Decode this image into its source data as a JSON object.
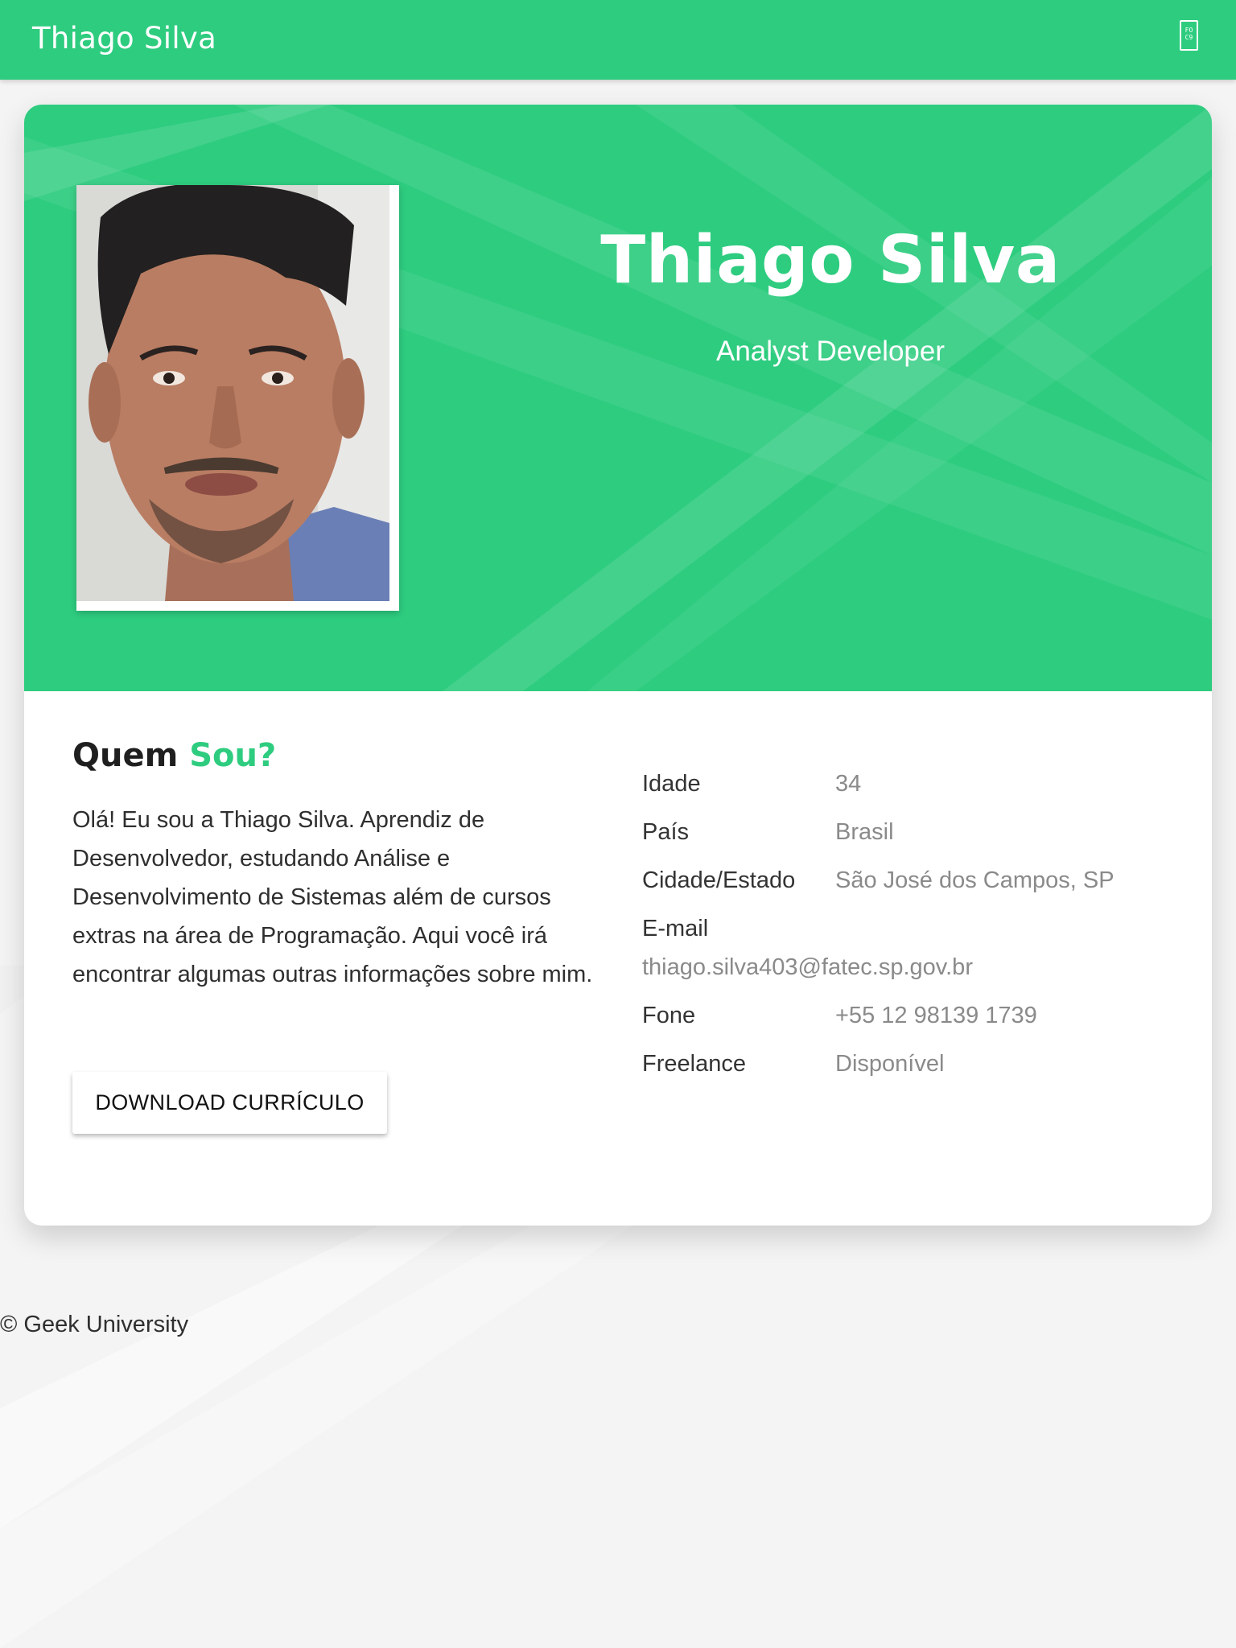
{
  "header": {
    "brand": "Thiago Silva",
    "menu_icon": "menu-icon",
    "menu_icon_glyph": "FO\nC9"
  },
  "colors": {
    "accent": "#2ecc7f",
    "page_bg": "#f4f4f4"
  },
  "hero": {
    "name": "Thiago Silva",
    "role": "Analyst Developer",
    "photo_icon": "profile-photo"
  },
  "about": {
    "title_part1": "Quem",
    "title_part2": "Sou?",
    "paragraph": "Olá! Eu sou a Thiago Silva. Aprendiz de Desenvolvedor, estudando Análise e Desenvolvimento de Sistemas além de cursos extras na área de Programação. Aqui você irá encontrar algumas outras informações sobre mim.",
    "download_label": "DOWNLOAD CURRÍCULO"
  },
  "info": [
    {
      "label": "Idade",
      "value": "34"
    },
    {
      "label": "País",
      "value": "Brasil"
    },
    {
      "label": "Cidade/Estado",
      "value": "São José dos Campos, SP"
    },
    {
      "label": "E-mail",
      "value": "thiago.silva403@fatec.sp.gov.br"
    },
    {
      "label": "Fone",
      "value": "+55 12 98139 1739"
    },
    {
      "label": "Freelance",
      "value": "Disponível"
    }
  ],
  "footer": {
    "text": "© Geek University"
  }
}
